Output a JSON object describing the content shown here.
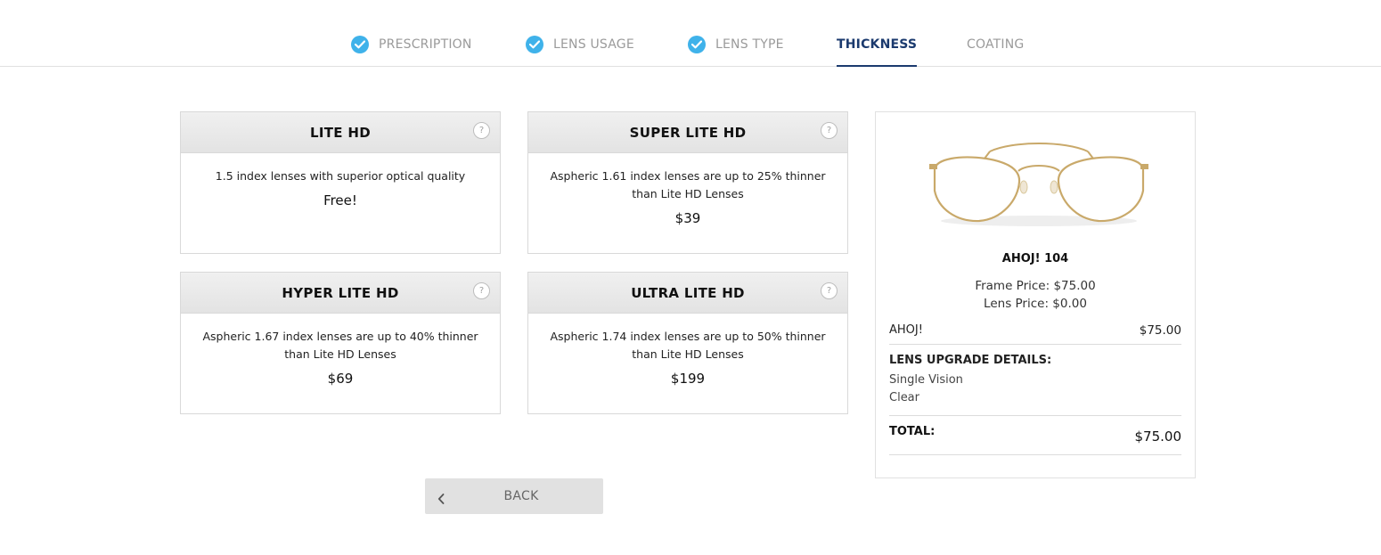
{
  "steps": [
    {
      "label": "PRESCRIPTION",
      "completed": true
    },
    {
      "label": "LENS USAGE",
      "completed": true
    },
    {
      "label": "LENS TYPE",
      "completed": true
    },
    {
      "label": "THICKNESS",
      "active": true
    },
    {
      "label": "COATING",
      "completed": false
    }
  ],
  "options": [
    {
      "title": "LITE HD",
      "help": "?",
      "description": "1.5 index lenses with superior optical quality",
      "price": "Free!"
    },
    {
      "title": "SUPER LITE HD",
      "help": "?",
      "description": "Aspheric 1.61 index lenses are up to 25% thinner than Lite HD Lenses",
      "price": "$39"
    },
    {
      "title": "HYPER LITE HD",
      "help": "?",
      "description": "Aspheric 1.67 index lenses are up to 40% thinner than Lite HD Lenses",
      "price": "$69"
    },
    {
      "title": "ULTRA LITE HD",
      "help": "?",
      "description": "Aspheric 1.74 index lenses are up to 50% thinner than Lite HD Lenses",
      "price": "$199"
    }
  ],
  "back": {
    "label": "BACK"
  },
  "summary": {
    "frame_name": "AHOJ! 104",
    "frame_price": "Frame Price: $75.00",
    "lens_price": "Lens Price: $0.00",
    "line_item": {
      "name": "AHOJ!",
      "amount": "$75.00"
    },
    "upgrade_title": "LENS UPGRADE DETAILS:",
    "upgrades": [
      "Single Vision",
      "Clear"
    ],
    "total_label": "TOTAL:",
    "total_amount": "$75.00"
  },
  "colors": {
    "accent_check": "#3fb2ea",
    "active_step": "#1b3a6e",
    "frame_gold": "#c9a96a",
    "temple_brown": "#4a3a2e"
  }
}
